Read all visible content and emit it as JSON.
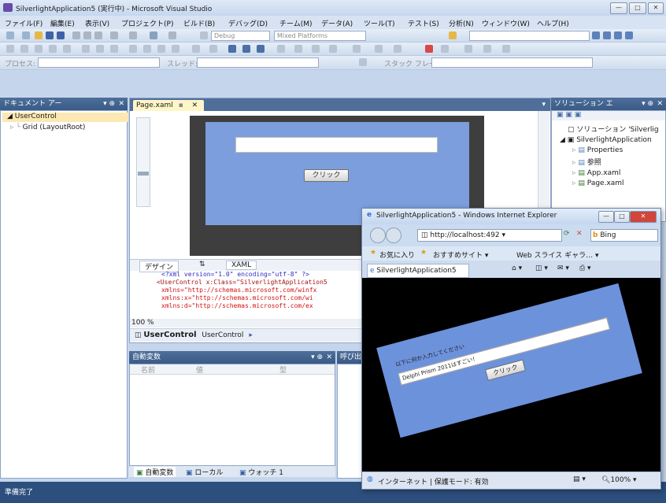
{
  "window": {
    "title": "SilverlightApplication5 (実行中) - Microsoft Visual Studio",
    "controls": [
      "—",
      "□",
      "✕"
    ]
  },
  "menu": [
    "ファイル(F)",
    "編集(E)",
    "表示(V)",
    "プロジェクト(P)",
    "ビルド(B)",
    "デバッグ(D)",
    "チーム(M)",
    "データ(A)",
    "ツール(T)",
    "テスト(S)",
    "分析(N)",
    "ウィンドウ(W)",
    "ヘルプ(H)"
  ],
  "toolbar": {
    "config": "Debug",
    "platform": "Mixed Platforms",
    "process_label": "プロセス:",
    "thread_label": "スレッド:",
    "stack_label": "スタック フレーム:"
  },
  "doc_outline": {
    "title": "ドキュメント アー",
    "items": [
      "UserControl",
      "Grid (LayoutRoot)"
    ]
  },
  "editor": {
    "tab": "Page.xaml",
    "textbox_value": "",
    "button_label": "クリック",
    "design_tab": "デザイン",
    "swap_tab": "⇅",
    "xaml_tab": "XAML",
    "zoom": "100 %",
    "breadcrumb_a": "UserControl",
    "breadcrumb_b": "UserControl",
    "code": [
      "<?xml version=\"1.0\" encoding=\"utf-8\" ?>",
      "<UserControl x:Class=\"SilverlightApplication5",
      "  xmlns=\"http://schemas.microsoft.com/winfx",
      "  xmlns:x=\"http://schemas.microsoft.com/wi",
      "  xmlns:d=\"http://schemas.microsoft.com/ex"
    ]
  },
  "solution": {
    "title": "ソリューション エ",
    "items": [
      "ソリューション 'Silverlig",
      "SilverlightApplication",
      "Properties",
      "参照",
      "App.xaml",
      "Page.xaml"
    ]
  },
  "autos": {
    "title": "自動変数",
    "col_name": "名前",
    "col_value": "値",
    "col_type": "型",
    "tabs": [
      "自動変数",
      "ローカル",
      "ウォッチ 1"
    ],
    "other_title": "呼び出"
  },
  "status": "準備完了",
  "ie": {
    "title": "SilverlightApplication5 - Windows Internet Explorer",
    "url": "http://localhost:492",
    "search": "Bing",
    "fav_label": "お気に入り",
    "fav_site": "おすすめサイト",
    "fav_web": "Web スライス ギャラ…",
    "tab": "SilverlightApplication5",
    "content_label": "以下に何か入力してください",
    "content_input": "Delphi Prism 2011はすごい！",
    "content_button": "クリック",
    "status": "インターネット | 保護モード: 有効",
    "zoom": "100%"
  }
}
